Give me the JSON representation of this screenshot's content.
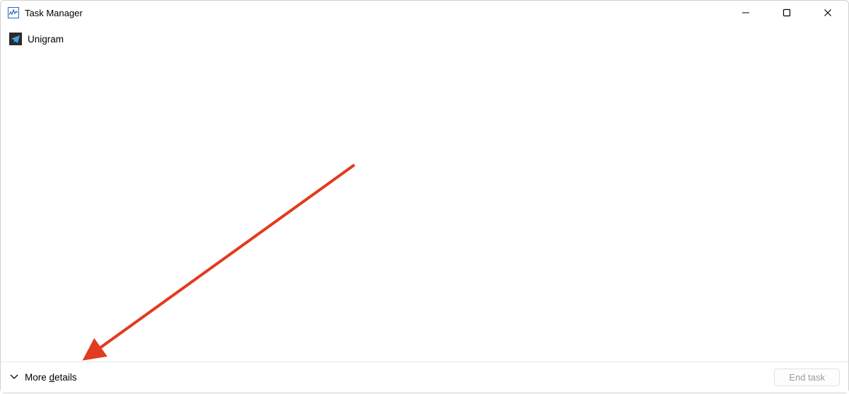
{
  "window": {
    "title": "Task Manager"
  },
  "processes": [
    {
      "name": "Unigram",
      "icon": "telegram"
    }
  ],
  "footer": {
    "more_details_prefix": "More ",
    "more_details_underlined": "d",
    "more_details_suffix": "etails"
  },
  "buttons": {
    "end_task": "End task"
  }
}
